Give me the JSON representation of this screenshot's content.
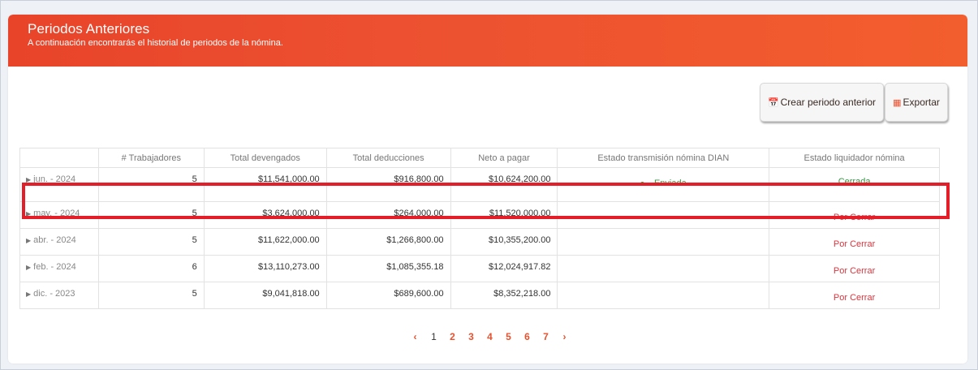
{
  "header": {
    "title": "Periodos Anteriores",
    "subtitle": "A continuación encontrarás el historial de periodos de la nómina."
  },
  "toolbar": {
    "create_label": "Crear periodo anterior",
    "export_label": "Exportar"
  },
  "table": {
    "columns": [
      "",
      "# Trabajadores",
      "Total devengados",
      "Total deducciones",
      "Neto a pagar",
      "Estado transmisión nómina DIAN",
      "Estado liquidador nómina"
    ],
    "rows": [
      {
        "period": "jun. - 2024",
        "workers": "5",
        "accrued": "$11,541,000.00",
        "deductions": "$916,800.00",
        "net": "$10,624,200.00",
        "dian": "Enviada",
        "liq": "Cerrada"
      },
      {
        "period": "may. - 2024",
        "workers": "5",
        "accrued": "$3,624,000.00",
        "deductions": "$264,000.00",
        "net": "$11,520,000.00",
        "dian": "",
        "liq": "Por Cerrar"
      },
      {
        "period": "abr. - 2024",
        "workers": "5",
        "accrued": "$11,622,000.00",
        "deductions": "$1,266,800.00",
        "net": "$10,355,200.00",
        "dian": "",
        "liq": "Por Cerrar"
      },
      {
        "period": "feb. - 2024",
        "workers": "6",
        "accrued": "$13,110,273.00",
        "deductions": "$1,085,355.18",
        "net": "$12,024,917.82",
        "dian": "",
        "liq": "Por Cerrar"
      },
      {
        "period": "dic. - 2023",
        "workers": "5",
        "accrued": "$9,041,818.00",
        "deductions": "$689,600.00",
        "net": "$8,352,218.00",
        "dian": "",
        "liq": "Por Cerrar"
      }
    ]
  },
  "pagination": {
    "prev": "‹",
    "pages": [
      "1",
      "2",
      "3",
      "4",
      "5",
      "6",
      "7"
    ],
    "next": "›",
    "current": "1"
  },
  "colors": {
    "accent": "#ec5030",
    "highlight": "#e41e28",
    "success": "#2f9b3f",
    "pending": "#d9363e"
  }
}
